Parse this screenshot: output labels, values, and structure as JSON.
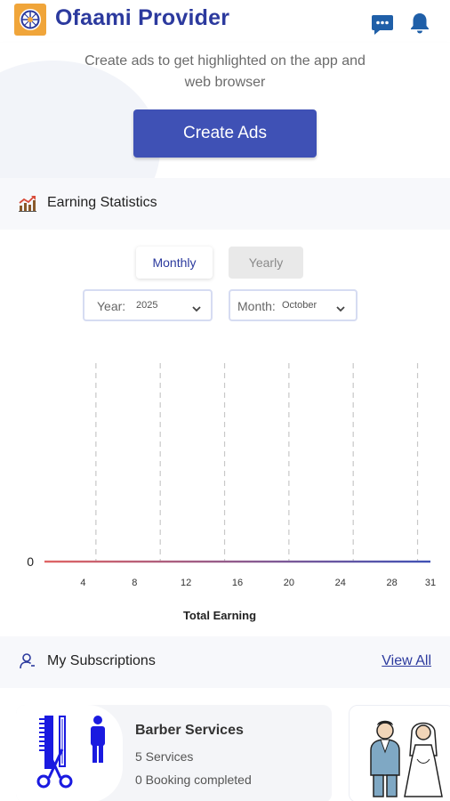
{
  "header": {
    "app_title": "Ofaami Provider",
    "icons": [
      "app-logo-icon",
      "chat-icon",
      "bell-icon"
    ],
    "brand_color": "#2c3a9e"
  },
  "promo": {
    "text_line1": "Create ads to get highlighted on the app and",
    "text_line2": "web browser",
    "button_label": "Create Ads",
    "button_color": "#3f51b5"
  },
  "earning_statistics": {
    "title": "Earning Statistics",
    "icon": "chart-growth-icon",
    "tabs": [
      {
        "label": "Monthly",
        "selected": true
      },
      {
        "label": "Yearly",
        "selected": false
      }
    ],
    "year_select": {
      "label": "Year:",
      "value": "2025"
    },
    "month_select": {
      "label": "Month:",
      "value": "October"
    }
  },
  "chart_data": {
    "type": "line",
    "xlabel": "Total Earning",
    "ylabel": "",
    "x_ticks": [
      4,
      8,
      12,
      16,
      20,
      24,
      28,
      31
    ],
    "y_ticks": [
      0
    ],
    "x_range": [
      1,
      31
    ],
    "series": [
      {
        "x": [
          1,
          2,
          3,
          4,
          5,
          6,
          7,
          8,
          9,
          10,
          11,
          12,
          13,
          14,
          15,
          16,
          17,
          18,
          19,
          20,
          21,
          22,
          23,
          24,
          25,
          26,
          27,
          28,
          29,
          30,
          31
        ],
        "values": [
          0,
          0,
          0,
          0,
          0,
          0,
          0,
          0,
          0,
          0,
          0,
          0,
          0,
          0,
          0,
          0,
          0,
          0,
          0,
          0,
          0,
          0,
          0,
          0,
          0,
          0,
          0,
          0,
          0,
          0,
          0
        ],
        "color_start": "#e06464",
        "color_end": "#3f51b5"
      }
    ],
    "vertical_grid_at": [
      5,
      10,
      15,
      20,
      25,
      30
    ],
    "grid": "dashed vertical"
  },
  "subscriptions": {
    "title": "My Subscriptions",
    "icon": "user-icon",
    "view_all_label": "View All",
    "cards": [
      {
        "title": "Barber Services",
        "services": "5 Services",
        "bookings": "0 Booking completed",
        "image_icon": "barber-icon"
      },
      {
        "image_icon": "wedding-couple-icon"
      }
    ]
  }
}
